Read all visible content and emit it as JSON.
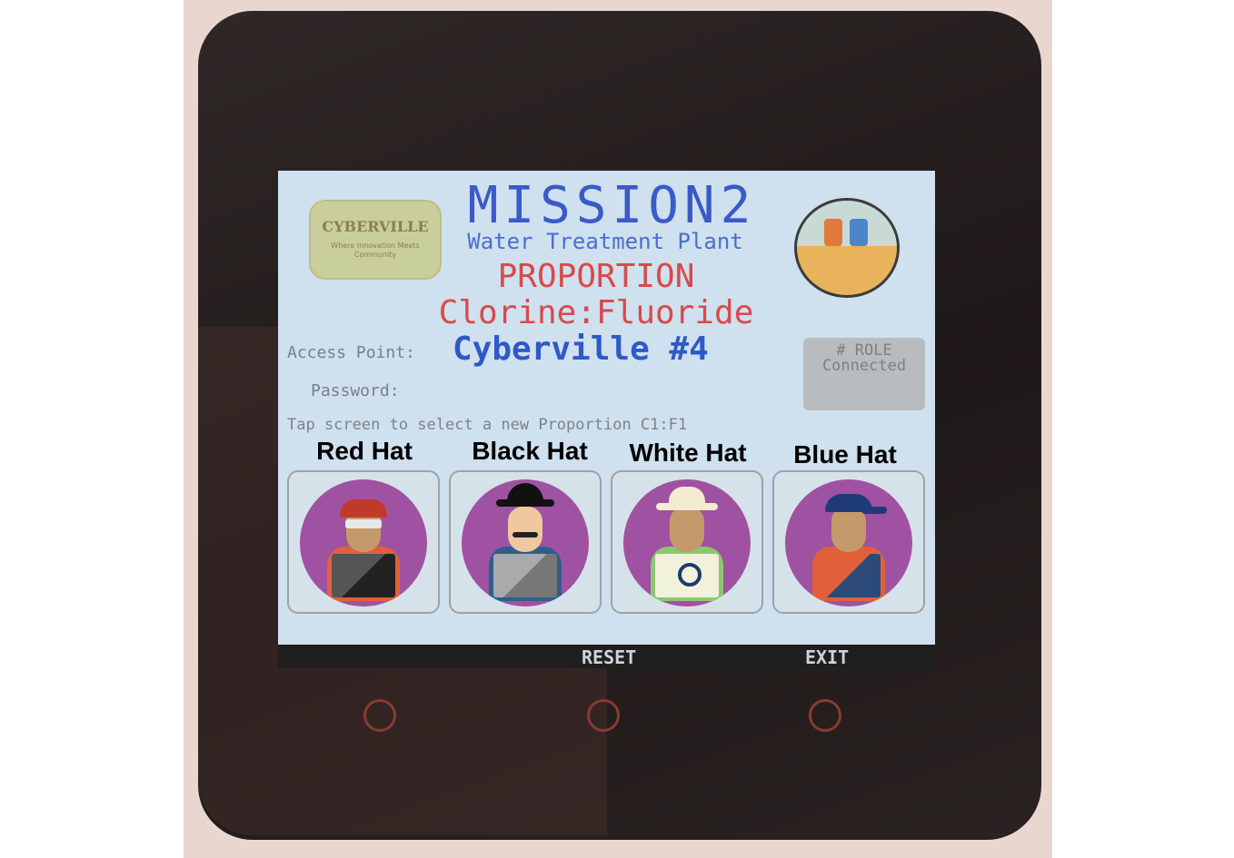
{
  "logos": {
    "left_title": "CYBERVILLE",
    "left_subtitle": "Where Innovation Meets Community",
    "right_icon": "water-plant-icon"
  },
  "header": {
    "mission": "MISSION2",
    "subtitle": "Water Treatment Plant",
    "proportion_title": "PROPORTION",
    "ratio": "Clorine:Fluoride"
  },
  "network": {
    "access_point_label": "Access Point:",
    "access_point_value": "Cyberville #4",
    "password_label": "Password:"
  },
  "role_box": {
    "line1": "# ROLE",
    "line2": "Connected"
  },
  "instruction": "Tap screen to select a new Proportion C1:F1",
  "hats": [
    {
      "label": "Red Hat",
      "icon": "red-hat-hacker-icon"
    },
    {
      "label": "Black Hat",
      "icon": "black-hat-hacker-icon"
    },
    {
      "label": "White Hat",
      "icon": "white-hat-hacker-icon"
    },
    {
      "label": "Blue Hat",
      "icon": "blue-hat-hacker-icon"
    }
  ],
  "soft_buttons": {
    "reset": "RESET",
    "exit": "EXIT"
  },
  "colors": {
    "screen_bg": "#cfe0ee",
    "mission_blue": "#3a5ac8",
    "proportion_red": "#d84a4a",
    "avatar_purple": "#a052a2"
  }
}
